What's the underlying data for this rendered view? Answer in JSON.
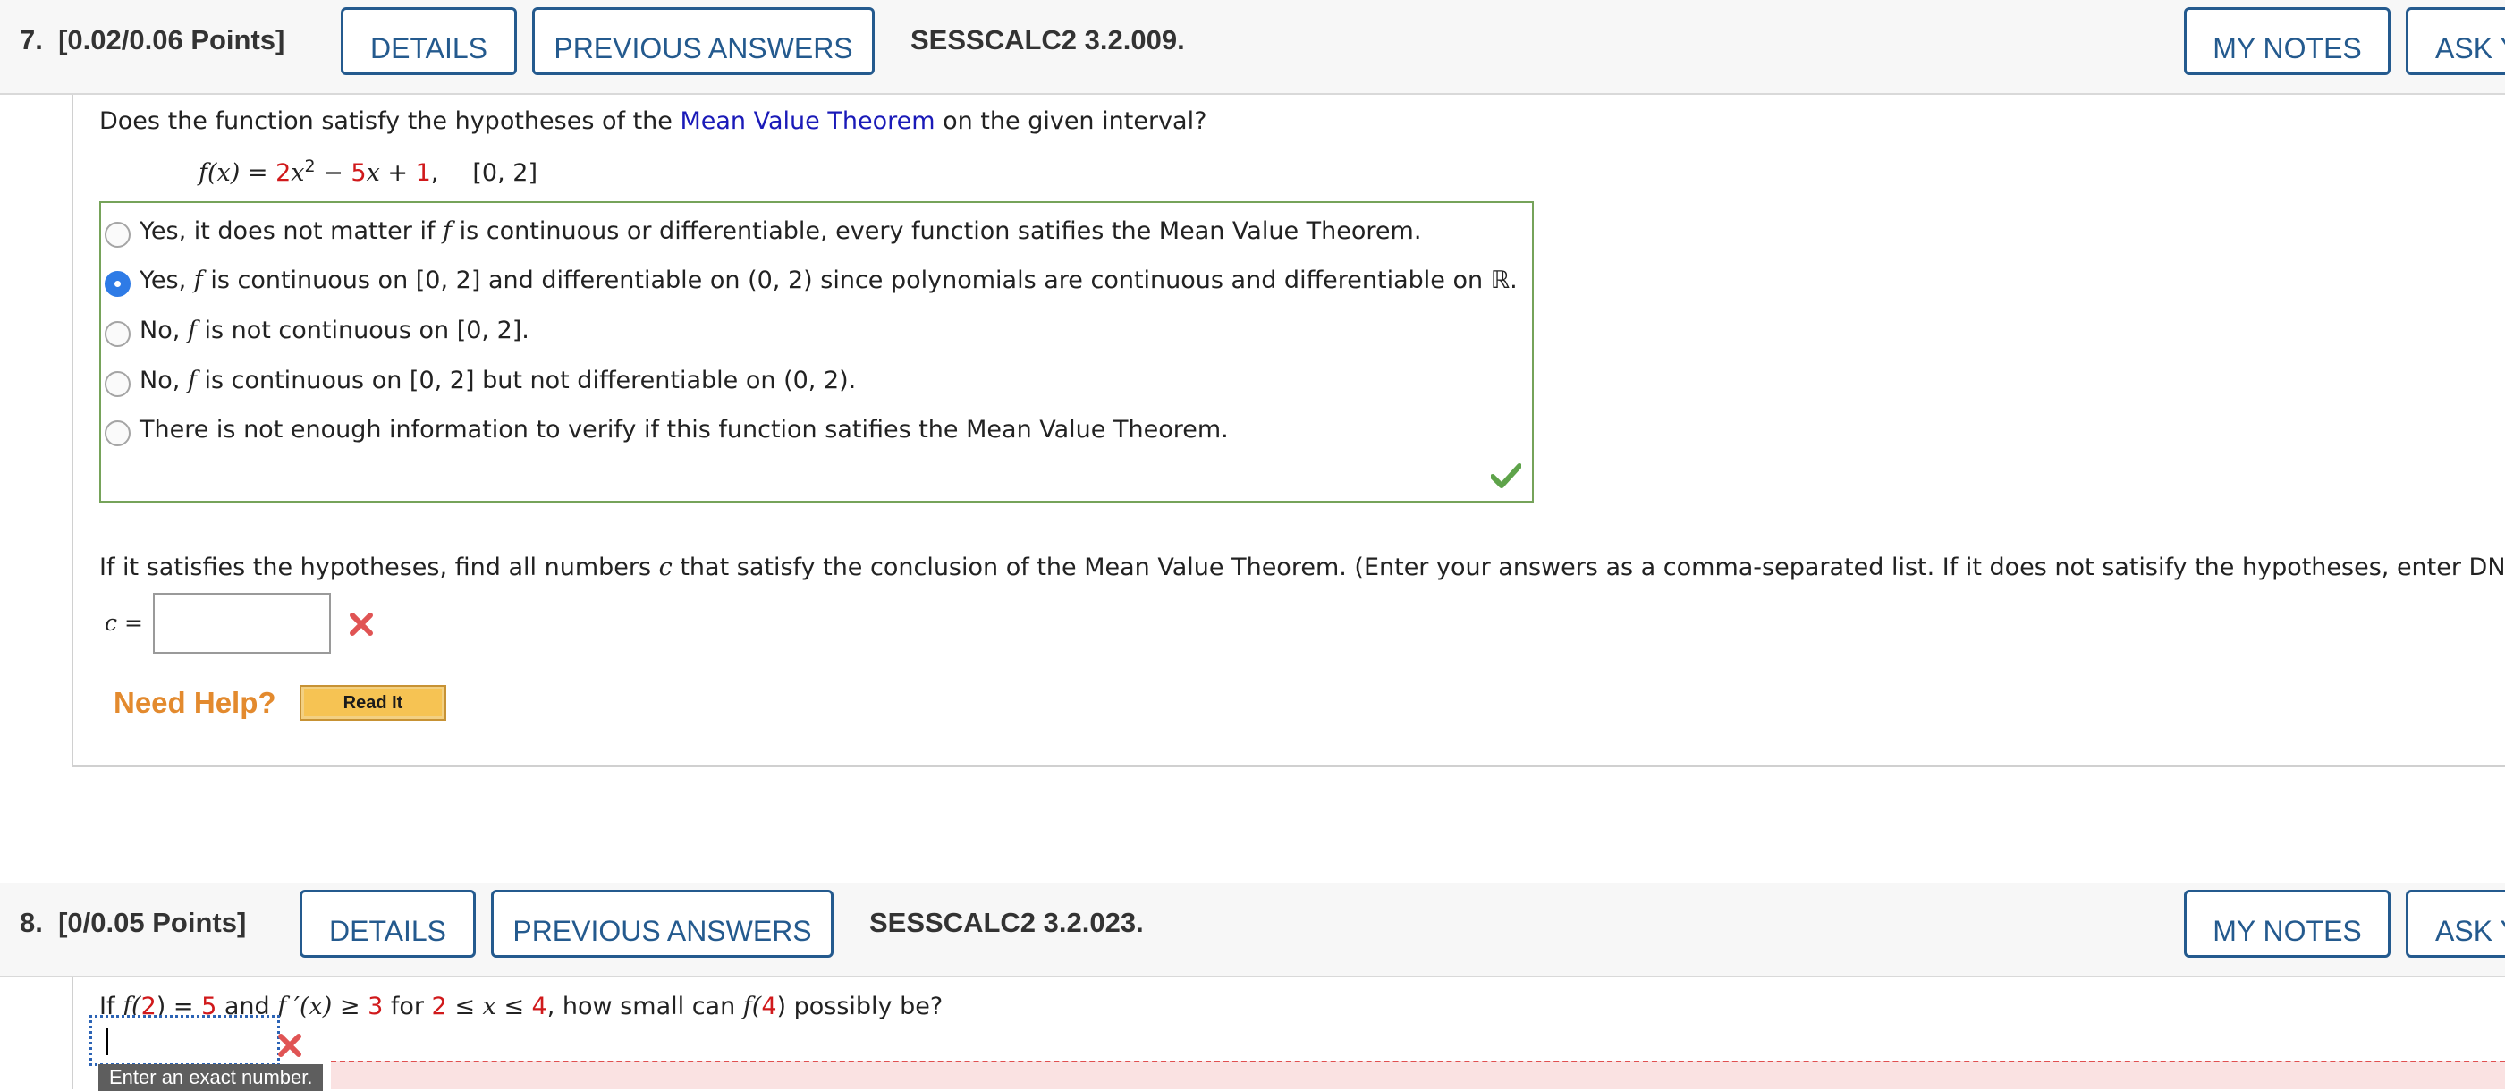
{
  "q7": {
    "number": "7.",
    "points": "[0.02/0.06 Points]",
    "details_label": "DETAILS",
    "previous_answers_label": "PREVIOUS ANSWERS",
    "problem_id": "SESSCALC2 3.2.009.",
    "my_notes_label": "MY NOTES",
    "ask_label": "ASK Y",
    "prompt_before": "Does the function satisfy the hypotheses of the ",
    "prompt_link": "Mean Value Theorem",
    "prompt_after": " on the given interval?",
    "fx_lhs": "f(x) = ",
    "fx_c1": "2",
    "fx_x": "x",
    "fx_exp": "2",
    "fx_minus": " − ",
    "fx_c2": "5",
    "fx_x2": "x",
    "fx_plus": " + ",
    "fx_c3": "1",
    "fx_comma": ",",
    "interval": "[0, 2]",
    "choices": [
      {
        "pre": "Yes, it does not matter if ",
        "f": "f",
        "post": " is continuous or differentiable, every function satifies the Mean Value Theorem.",
        "selected": false
      },
      {
        "pre": "Yes, ",
        "f": "f",
        "post": " is continuous on [0, 2] and differentiable on (0, 2) since polynomials are continuous and differentiable on ℝ.",
        "selected": true
      },
      {
        "pre": "No, ",
        "f": "f",
        "post": " is not continuous on [0, 2].",
        "selected": false
      },
      {
        "pre": "No, ",
        "f": "f",
        "post": " is continuous on [0, 2] but not differentiable on (0, 2).",
        "selected": false
      },
      {
        "pre": "There is not enough information to verify if this function satifies the Mean Value Theorem.",
        "f": "",
        "post": "",
        "selected": false
      }
    ],
    "followup_pre": "If it satisfies the hypotheses, find all numbers ",
    "followup_c": "c",
    "followup_post": " that satisfy the conclusion of the Mean Value Theorem. (Enter your answers as a comma-separated list. If it does not satisify the hypotheses, enter DNE).",
    "c_label": "c =",
    "c_value": "",
    "need_help": "Need Help?",
    "read_it": "Read It"
  },
  "q8": {
    "number": "8.",
    "points": "[0/0.05 Points]",
    "details_label": "DETAILS",
    "previous_answers_label": "PREVIOUS ANSWERS",
    "problem_id": "SESSCALC2 3.2.023.",
    "my_notes_label": "MY NOTES",
    "ask_label": "ASK Y",
    "p1": "If ",
    "p_f2": "f(",
    "p_2": "2",
    "p_close": ") = ",
    "p_5": "5",
    "p_and": " and ",
    "p_fprime": "f ′(x) ≥ ",
    "p_3": "3",
    "p_for": " for ",
    "p_2b": "2",
    "p_ineq": " ≤ x ≤ ",
    "p_4": "4",
    "p_how": ", how small can ",
    "p_f4": "f(",
    "p_4b": "4",
    "p_end": ") possibly be?",
    "answer_value": "",
    "tooltip": "Enter an exact number."
  },
  "colors": {
    "button_border": "#245a8e",
    "link_blue": "#1a1ab8",
    "constant_red": "#d0191b",
    "correct_green": "#76a35a",
    "need_help_orange": "#e38a2e",
    "radio_selected": "#2e7be6"
  }
}
